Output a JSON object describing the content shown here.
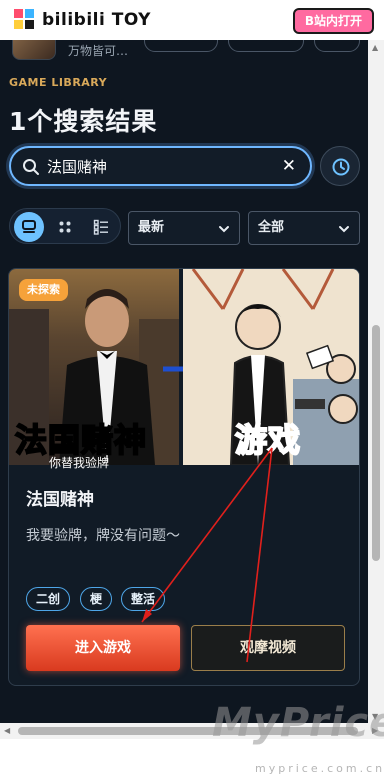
{
  "header": {
    "logo_text": "bilibili TOY",
    "open_in_app": "B站内打开"
  },
  "partial_row": {
    "text": "万物皆可…"
  },
  "section": {
    "label": "GAME LIBRARY",
    "result_title": "1个搜索结果"
  },
  "search": {
    "value": "法国赌神",
    "clear_icon": "close-icon",
    "history_icon": "history-icon"
  },
  "filters": {
    "sort_selected": "最新",
    "category_selected": "全部",
    "view_modes": [
      "card-view-icon",
      "grid-view-icon",
      "list-view-icon"
    ]
  },
  "card": {
    "badge": "未探索",
    "thumb_left_caption": "法国赌神",
    "thumb_right_caption": "游戏",
    "thumb_subtitle": "你替我验牌",
    "title": "法国赌神",
    "description": "我要验牌，牌没有问题～",
    "tags": [
      "二创",
      "梗",
      "整活"
    ],
    "play_button": "进入游戏",
    "watch_button": "观摩视频"
  },
  "watermark": {
    "main": "MyPrice",
    "sub": "myprice.com.cn"
  },
  "colors": {
    "app_bg": "#0e1620",
    "accent_blue": "#6ec2ff",
    "accent_orange": "#d9a95a",
    "play_red": "#e4482a",
    "open_pink": "#ff6aa0"
  }
}
